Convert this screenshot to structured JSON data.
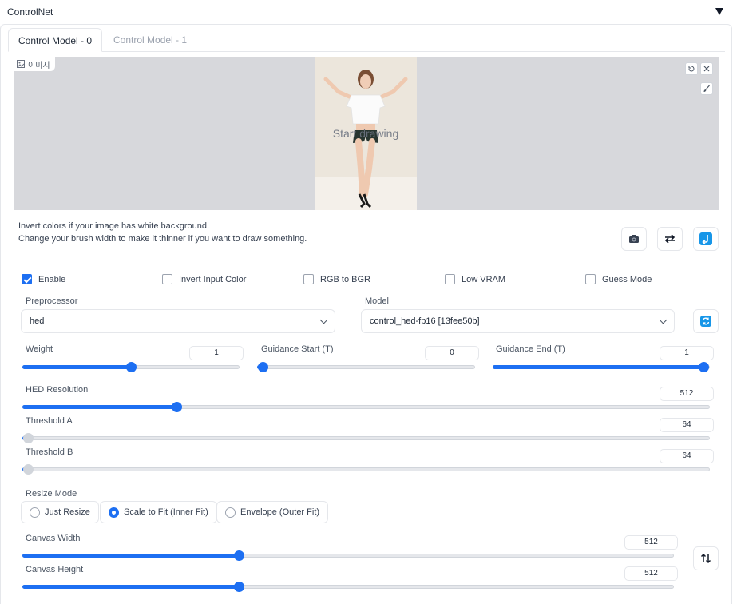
{
  "section": {
    "title": "ControlNet"
  },
  "tabs": [
    {
      "label": "Control Model - 0"
    },
    {
      "label": "Control Model - 1"
    }
  ],
  "canvas": {
    "image_label": "이미지",
    "placeholder": "Start drawing"
  },
  "hints": [
    "Invert colors if your image has white background.",
    "Change your brush width to make it thinner if you want to draw something."
  ],
  "checkboxes": [
    {
      "label": "Enable",
      "checked": true
    },
    {
      "label": "Invert Input Color",
      "checked": false
    },
    {
      "label": "RGB to BGR",
      "checked": false
    },
    {
      "label": "Low VRAM",
      "checked": false
    },
    {
      "label": "Guess Mode",
      "checked": false
    }
  ],
  "preprocessor": {
    "label": "Preprocessor",
    "value": "hed"
  },
  "model": {
    "label": "Model",
    "value": "control_hed-fp16 [13fee50b]"
  },
  "sliders": {
    "weight": {
      "label": "Weight",
      "value": "1",
      "fraction": 0.5
    },
    "guidance_start": {
      "label": "Guidance Start (T)",
      "value": "0",
      "fraction": 0.0
    },
    "guidance_end": {
      "label": "Guidance End (T)",
      "value": "1",
      "fraction": 1.0
    },
    "hed_resolution": {
      "label": "HED Resolution",
      "value": "512",
      "fraction": 0.22
    },
    "threshold_a": {
      "label": "Threshold A",
      "value": "64",
      "fraction": 0.0
    },
    "threshold_b": {
      "label": "Threshold B",
      "value": "64",
      "fraction": 0.0
    },
    "canvas_width": {
      "label": "Canvas Width",
      "value": "512",
      "fraction": 0.33
    },
    "canvas_height": {
      "label": "Canvas Height",
      "value": "512",
      "fraction": 0.33
    }
  },
  "resize_mode": {
    "label": "Resize Mode",
    "options": [
      "Just Resize",
      "Scale to Fit (Inner Fit)",
      "Envelope (Outer Fit)"
    ],
    "selected": "Scale to Fit (Inner Fit)"
  },
  "colors": {
    "accent": "#1d6ff2",
    "canvas_bg": "#d7d8dc"
  }
}
